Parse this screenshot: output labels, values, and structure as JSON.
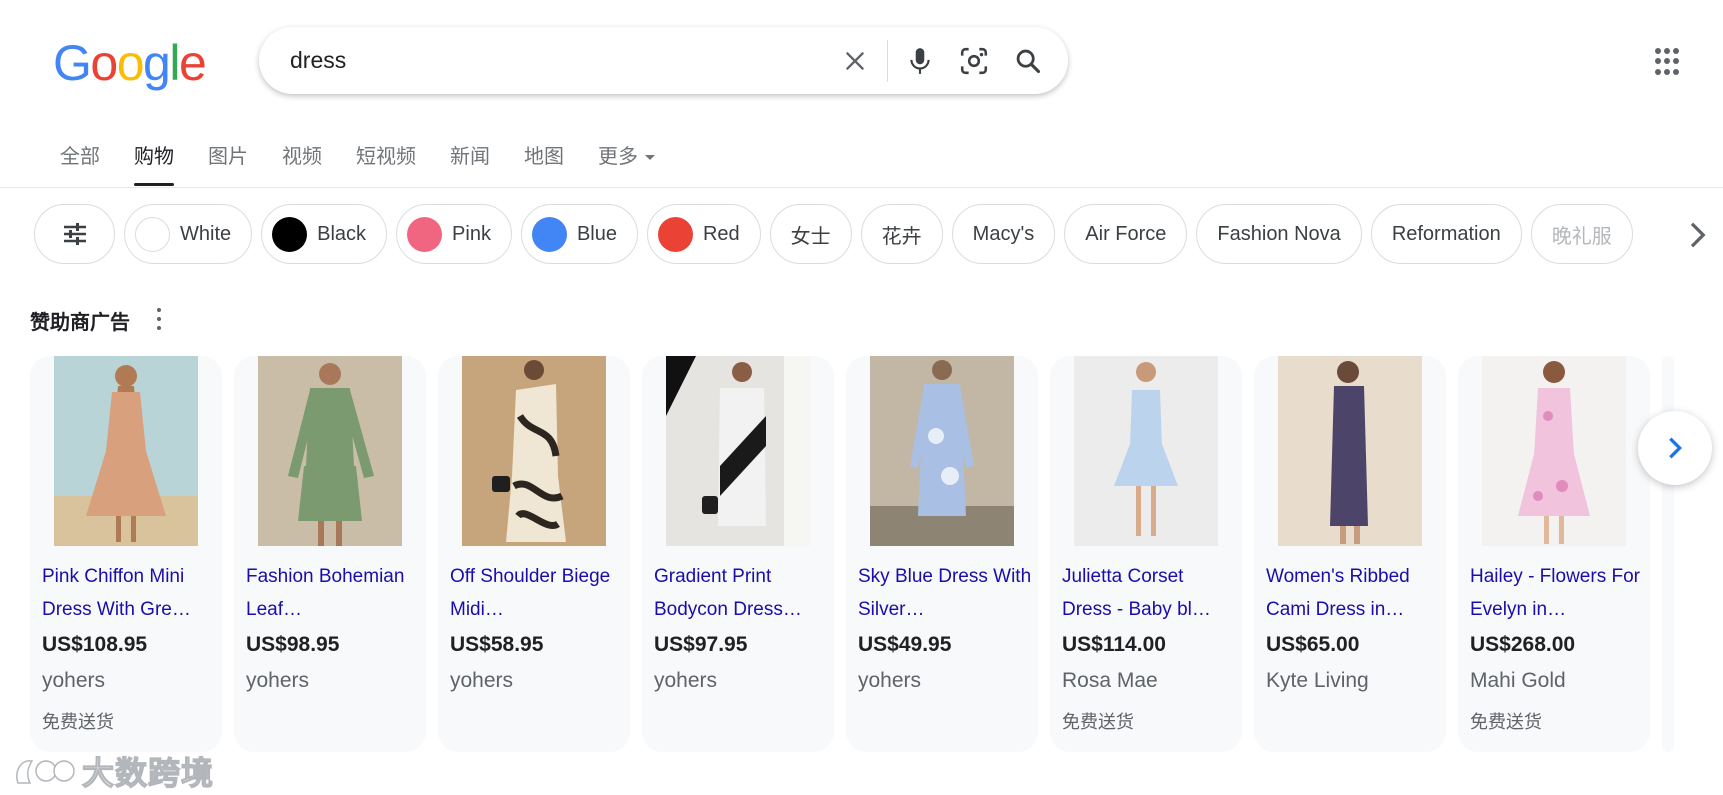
{
  "logo": {
    "letters": [
      "G",
      "o",
      "o",
      "g",
      "l",
      "e"
    ]
  },
  "search": {
    "query": "dress"
  },
  "tabs": [
    {
      "label": "全部"
    },
    {
      "label": "购物",
      "active": true
    },
    {
      "label": "图片"
    },
    {
      "label": "视频"
    },
    {
      "label": "短视频"
    },
    {
      "label": "新闻"
    },
    {
      "label": "地图"
    },
    {
      "label": "更多"
    }
  ],
  "chips": [
    {
      "label": "White",
      "swatch": "#ffffff"
    },
    {
      "label": "Black",
      "swatch": "#000000"
    },
    {
      "label": "Pink",
      "swatch": "#f06680"
    },
    {
      "label": "Blue",
      "swatch": "#4285f4"
    },
    {
      "label": "Red",
      "swatch": "#ea4335"
    },
    {
      "label": "女士"
    },
    {
      "label": "花卉"
    },
    {
      "label": "Macy's"
    },
    {
      "label": "Air Force"
    },
    {
      "label": "Fashion Nova"
    },
    {
      "label": "Reformation"
    },
    {
      "label": "晚礼服"
    }
  ],
  "sponsored": {
    "heading": "赞助商广告"
  },
  "products": [
    {
      "title": "Pink Chiffon Mini Dress With Gre…",
      "price": "US$108.95",
      "merchant": "yohers",
      "shipping": "免费送货",
      "dress_color": "#d9a07e",
      "bg": "#b9d4d6"
    },
    {
      "title": "Fashion Bohemian Leaf…",
      "price": "US$98.95",
      "merchant": "yohers",
      "shipping": "",
      "dress_color": "#7c9a6f",
      "bg": "#c9bda8"
    },
    {
      "title": "Off Shoulder Biege Midi…",
      "price": "US$58.95",
      "merchant": "yohers",
      "shipping": "",
      "dress_color": "#efe6d4",
      "bg": "#c6a57d"
    },
    {
      "title": "Gradient Print Bodycon Dress…",
      "price": "US$97.95",
      "merchant": "yohers",
      "shipping": "",
      "dress_color": "#f2f2f2",
      "bg": "#e6e4e0"
    },
    {
      "title": "Sky Blue Dress With Silver…",
      "price": "US$49.95",
      "merchant": "yohers",
      "shipping": "",
      "dress_color": "#a9bfe3",
      "bg": "#c2b7a4"
    },
    {
      "title": "Julietta Corset Dress - Baby bl…",
      "price": "US$114.00",
      "merchant": "Rosa Mae",
      "shipping": "免费送货",
      "dress_color": "#bcd3ee",
      "bg": "#ececec"
    },
    {
      "title": "Women's Ribbed Cami Dress in…",
      "price": "US$65.00",
      "merchant": "Kyte Living",
      "shipping": "",
      "dress_color": "#4d4569",
      "bg": "#e8dccd"
    },
    {
      "title": "Hailey - Flowers For Evelyn in…",
      "price": "US$268.00",
      "merchant": "Mahi Gold",
      "shipping": "免费送货",
      "dress_color": "#f1c3dc",
      "bg": "#f4f1f1"
    }
  ],
  "watermark": {
    "text": "大数跨境"
  }
}
